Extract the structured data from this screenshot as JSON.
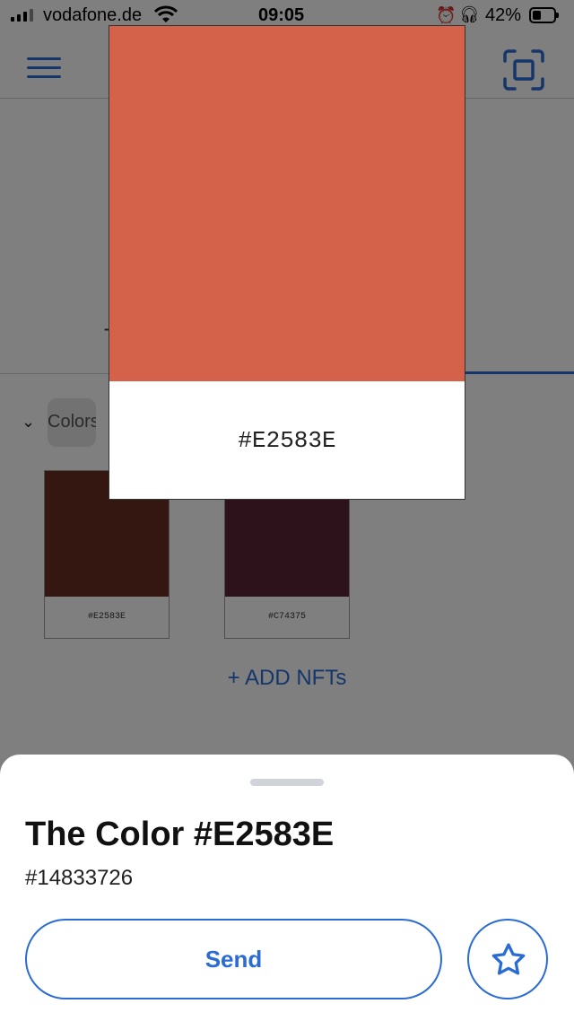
{
  "status_bar": {
    "carrier": "vodafone.de",
    "time": "09:05",
    "battery_percent": "42%",
    "battery_level": 0.42,
    "icons": [
      "signal-icon",
      "wifi-icon",
      "alarm-icon",
      "headphones-icon",
      "battery-icon"
    ]
  },
  "header": {
    "menu_icon": "menu-icon",
    "scan_icon": "scan-icon"
  },
  "tabs": {
    "partial_label": "T"
  },
  "collection": {
    "name_partial": "Colors"
  },
  "nfts": [
    {
      "label": "#E2583E",
      "color": "#6b2e22"
    },
    {
      "label": "#C74375",
      "color": "#5c2436"
    }
  ],
  "add_nfts_label": "+ ADD NFTs",
  "preview": {
    "color": "#d4614a",
    "label": "#E2583E"
  },
  "sheet": {
    "title": "The Color #E2583E",
    "token_id": "#14833726",
    "send_label": "Send",
    "favorite_icon": "star-icon"
  },
  "colors": {
    "accent": "#2b6cd4",
    "overlay": "rgba(0,0,0,0.5)"
  }
}
